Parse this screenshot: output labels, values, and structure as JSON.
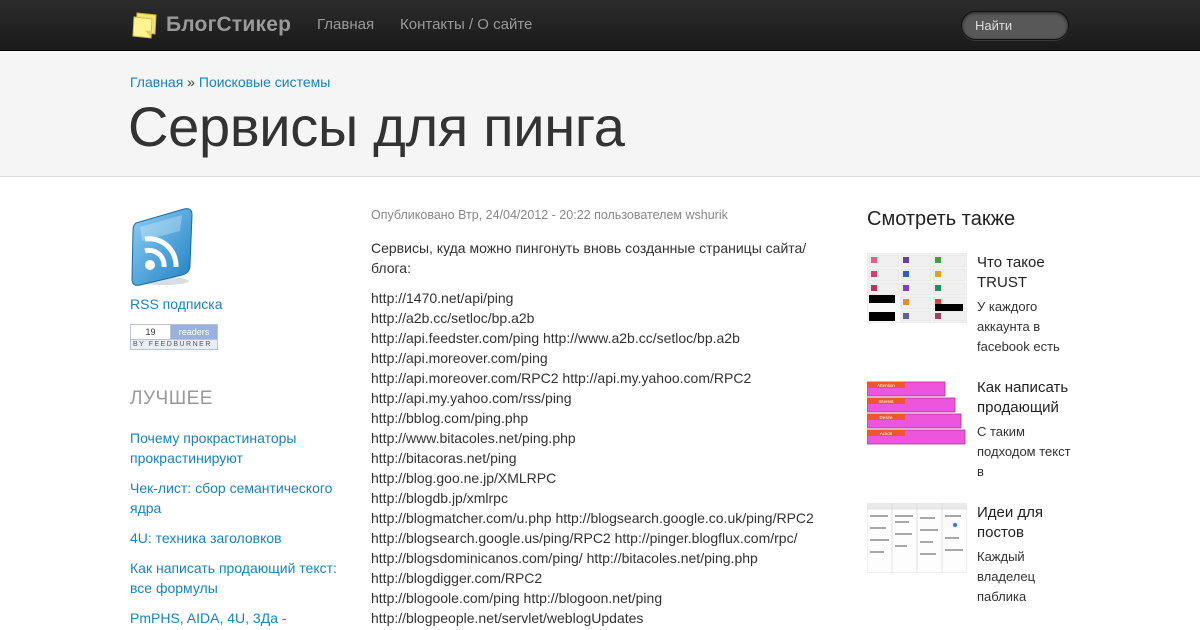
{
  "navbar": {
    "brand": "БлогСтикер",
    "links": [
      "Главная",
      "Контакты / О сайте"
    ],
    "search_placeholder": "Найти"
  },
  "breadcrumb": {
    "home": "Главная",
    "separator": " » ",
    "section": "Поисковые системы"
  },
  "page_title": "Сервисы для пинга",
  "left_sidebar": {
    "rss_label": "RSS подписка",
    "feedburner": {
      "count": "19",
      "label": "readers",
      "by": "BY FEEDBURNER"
    },
    "best_title": "ЛУЧШЕЕ",
    "best_items": [
      "Почему прокрастинаторы прокрастинируют",
      "Чек-лист: сбор семантического ядра",
      "4U: техника заголовков",
      "Как написать продающий текст: все формулы",
      "PmPHS, AIDA, 4U, 3Да -"
    ]
  },
  "article": {
    "meta": "Опубликовано Втр, 24/04/2012 - 20:22 пользователем wshurik",
    "intro": "Сервисы, куда можно пингонуть вновь созданные страницы сайта/блога:",
    "urls": [
      "http://1470.net/api/ping",
      "http://a2b.cc/setloc/bp.a2b",
      "http://api.feedster.com/ping http://www.a2b.cc/setloc/bp.a2b",
      "http://api.moreover.com/ping",
      "http://api.moreover.com/RPC2 http://api.my.yahoo.com/RPC2",
      "http://api.my.yahoo.com/rss/ping",
      "http://bblog.com/ping.php",
      "http://www.bitacoles.net/ping.php",
      "http://bitacoras.net/ping",
      "http://blog.goo.ne.jp/XMLRPC",
      "http://blogdb.jp/xmlrpc",
      "http://blogmatcher.com/u.php http://blogsearch.google.co.uk/ping/RPC2",
      "http://blogsearch.google.us/ping/RPC2 http://pinger.blogflux.com/rpc/",
      "http://blogsdominicanos.com/ping/ http://bitacoles.net/ping.php",
      "http://blogdigger.com/RPC2",
      "http://blogoole.com/ping http://blogoon.net/ping",
      "http://blogpeople.net/servlet/weblogUpdates"
    ]
  },
  "right_sidebar": {
    "title": "Смотреть также",
    "items": [
      {
        "title": "Что такое TRUST",
        "excerpt": "У каждого аккаунта в facebook есть"
      },
      {
        "title": "Как написать продающий",
        "excerpt": "С таким подходом текст в"
      },
      {
        "title": "Идеи для постов",
        "excerpt": "Каждый владелец паблика"
      }
    ],
    "aida_thumb_labels": [
      "Attention",
      "Interest",
      "Desire",
      "Action"
    ]
  },
  "colors": {
    "link": "#1a84b8",
    "navbar_bg": "#222222",
    "header_band": "#f5f5f5",
    "aida_bar": "#ee55dd",
    "aida_label_bg": "#ee5533"
  }
}
